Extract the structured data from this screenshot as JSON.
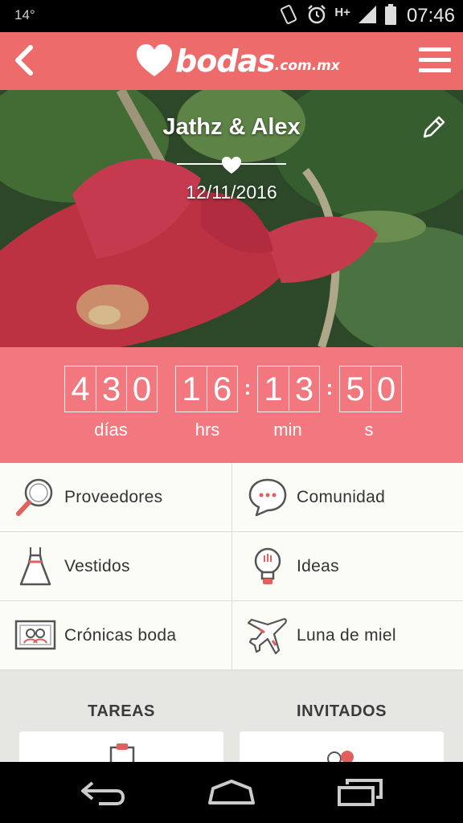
{
  "status_bar": {
    "temperature": "14°",
    "network": "H+",
    "time": "07:46"
  },
  "header": {
    "logo_word": "bodas",
    "logo_domain": ".com.mx"
  },
  "hero": {
    "couple": "Jathz & Alex",
    "date": "12/11/2016"
  },
  "countdown": {
    "days": [
      "4",
      "3",
      "0"
    ],
    "hours": [
      "1",
      "6"
    ],
    "minutes": [
      "1",
      "3"
    ],
    "seconds": [
      "5",
      "0"
    ],
    "labels": {
      "days": "días",
      "hours": "hrs",
      "minutes": "min",
      "seconds": "s"
    }
  },
  "menu": {
    "proveedores": "Proveedores",
    "comunidad": "Comunidad",
    "vestidos": "Vestidos",
    "ideas": "Ideas",
    "cronicas": "Crónicas boda",
    "luna": "Luna de miel"
  },
  "sections": {
    "tareas": "TAREAS",
    "invitados": "INVITADOS"
  },
  "colors": {
    "header": "#ee6b6b",
    "countdown": "#f2777e",
    "accent_icon": "#e0605e"
  }
}
